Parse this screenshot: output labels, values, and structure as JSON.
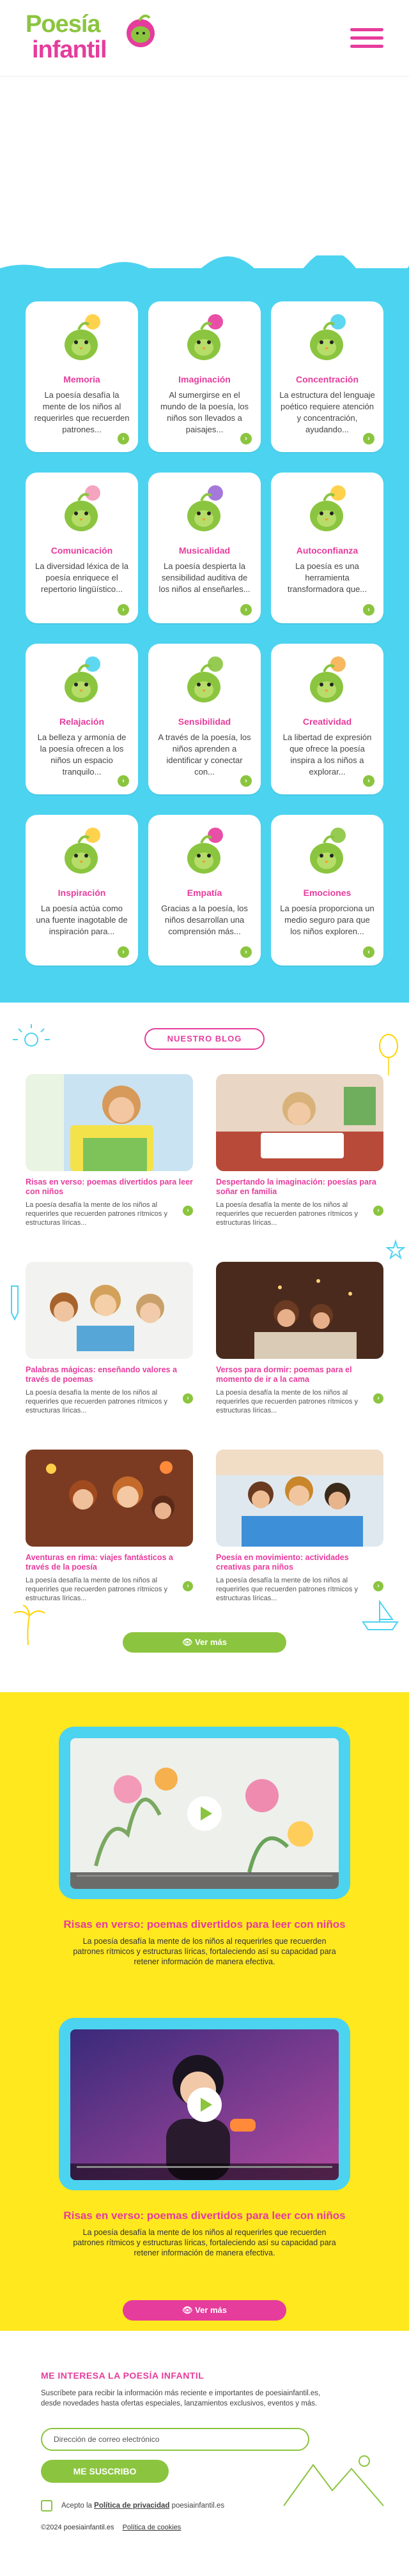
{
  "header": {
    "logo_line1": "Poesía",
    "logo_line2": "infantil"
  },
  "benefits": [
    {
      "title": "Memoria",
      "desc": "La poesía desafía la mente de los niños al requerirles que recuerden patrones..."
    },
    {
      "title": "Imaginación",
      "desc": "Al sumergirse en el mundo de la poesía, los niños son llevados a paisajes..."
    },
    {
      "title": "Concentración",
      "desc": "La estructura del lenguaje poético requiere atención y concentración, ayudando..."
    },
    {
      "title": "Comunicación",
      "desc": "La diversidad léxica de la poesía enriquece el repertorio lingüístico..."
    },
    {
      "title": "Musicalidad",
      "desc": "La poesía despierta la sensibilidad auditiva de los niños al enseñarles..."
    },
    {
      "title": "Autoconfianza",
      "desc": "La poesía es una herramienta transformadora que..."
    },
    {
      "title": "Relajación",
      "desc": "La belleza y armonía de la poesía ofrecen a los niños un espacio tranquilo..."
    },
    {
      "title": "Sensibilidad",
      "desc": "A través de la poesía, los niños aprenden a identificar y conectar con..."
    },
    {
      "title": "Creatividad",
      "desc": "La libertad de expresión que ofrece la poesía inspira a los niños a explorar..."
    },
    {
      "title": "Inspiración",
      "desc": "La poesía actúa como una fuente inagotable de inspiración para..."
    },
    {
      "title": "Empatía",
      "desc": "Gracias a la poesía, los niños desarrollan una comprensión más..."
    },
    {
      "title": "Emociones",
      "desc": "La poesía proporciona un medio seguro para que los niños exploren..."
    }
  ],
  "blog": {
    "badge": "NUESTRO BLOG",
    "posts": [
      {
        "title": "Risas en verso: poemas divertidos para leer con niños",
        "desc": "La poesía desafía la mente de los niños al requerirles que recuerden patrones rítmicos y estructuras líricas..."
      },
      {
        "title": "Despertando la imaginación: poesías para soñar en familia",
        "desc": "La poesía desafía la mente de los niños al requerirles que recuerden patrones rítmicos y estructuras líricas..."
      },
      {
        "title": "Palabras mágicas: enseñando valores a través de poemas",
        "desc": "La poesía desafía la mente de los niños al requerirles que recuerden patrones rítmicos y estructuras líricas..."
      },
      {
        "title": "Versos para dormir: poemas para el momento de ir a la cama",
        "desc": "La poesía desafía la mente de los niños al requerirles que recuerden patrones rítmicos y estructuras líricas..."
      },
      {
        "title": "Aventuras en rima: viajes fantásticos a través de la poesía",
        "desc": "La poesía desafía la mente de los niños al requerirles que recuerden patrones rítmicos y estructuras líricas..."
      },
      {
        "title": "Poesía en movimiento: actividades creativas para niños",
        "desc": "La poesía desafía la mente de los niños al requerirles que recuerden patrones rítmicos y estructuras líricas..."
      }
    ],
    "more_label": "Ver más"
  },
  "videos": {
    "items": [
      {
        "title": "Risas en verso: poemas divertidos para leer con niños",
        "desc": "La poesía desafía la mente de los niños al requerirles que recuerden patrones rítmicos y estructuras líricas, fortaleciendo así su capacidad para retener información de manera efectiva."
      },
      {
        "title": "Risas en verso: poemas divertidos para leer con niños",
        "desc": "La poesía desafía la mente de los niños al requerirles que recuerden patrones rítmicos y estructuras líricas, fortaleciendo así su capacidad para retener información de manera efectiva."
      }
    ],
    "more_label": "Ver más"
  },
  "newsletter": {
    "title": "ME INTERESA LA POESÍA INFANTIL",
    "desc": "Suscríbete para recibir la información más reciente e importantes de poesiainfantil.es, desde novedades hasta ofertas especiales, lanzamientos exclusivos, eventos y más.",
    "email_placeholder": "Dirección de correo electrónico",
    "subscribe_label": "ME SUSCRIBO",
    "accept_prefix": "Acepto la",
    "privacy_label": "Política de privacidad",
    "accept_suffix": "poesiainfantil.es"
  },
  "footer": {
    "copyright": "©2024 poesiainfantil.es",
    "cookies_label": "Política de cookies"
  },
  "colors": {
    "pink": "#e63c9c",
    "green": "#8bc53f",
    "blue": "#4cd3f0",
    "yellow": "#ffe81e"
  }
}
